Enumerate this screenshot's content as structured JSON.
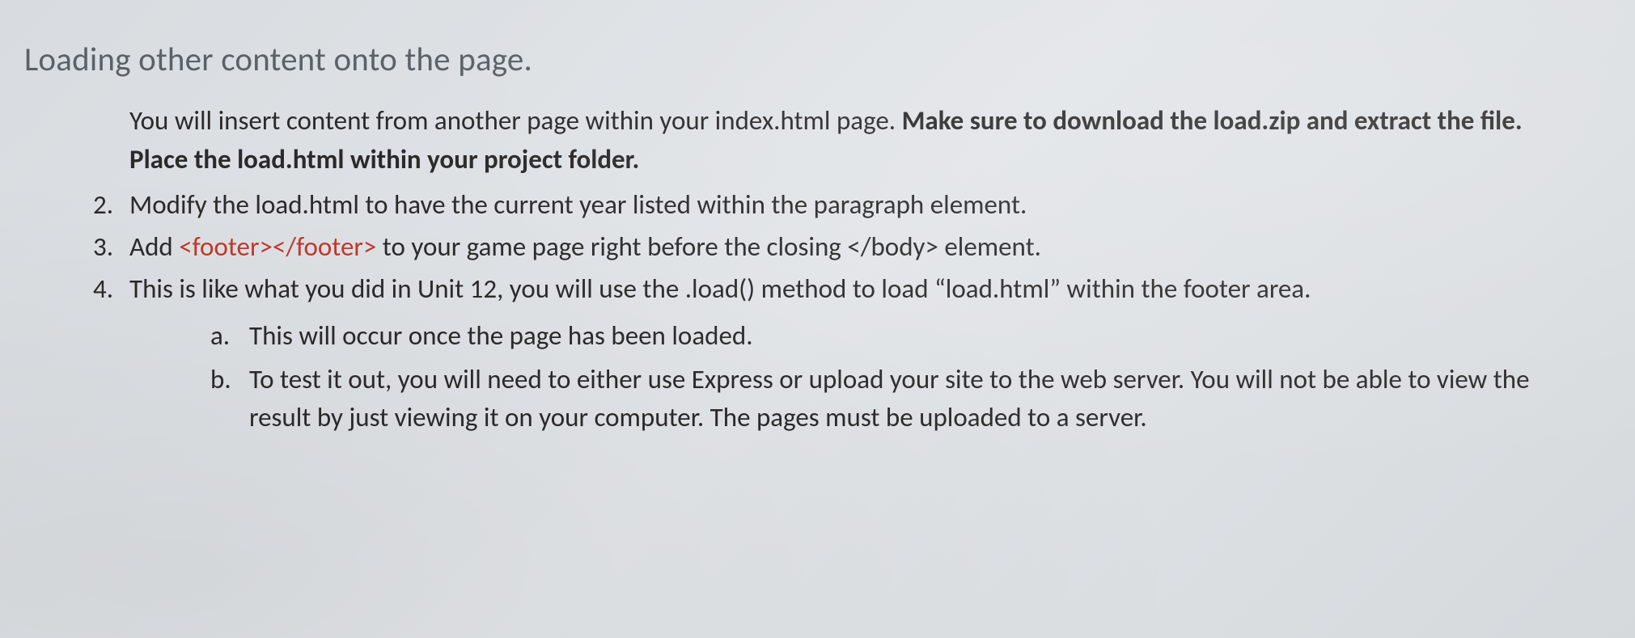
{
  "heading": "Loading other content onto the page.",
  "intro": {
    "text1": "You will insert content from another page within your index.html page. ",
    "boldText": "Make sure to download the load.zip and extract the file. Place the load.html within your project folder."
  },
  "items": [
    {
      "num": "2.",
      "text": "Modify the load.html to have the current year listed within the paragraph element."
    },
    {
      "num": "3.",
      "parts": {
        "before": "Add ",
        "code": "<footer></footer>",
        "after": "  to your game page right before the closing </body> element."
      }
    },
    {
      "num": "4.",
      "text": "This is like what you did in Unit 12, you will use the .load() method to load “load.html” within the footer area.",
      "sub": [
        {
          "num": "a.",
          "text": "This will occur once the page has been loaded."
        },
        {
          "num": "b.",
          "text": "To test it out, you will need to either use Express or upload your site to the web server. You will not be able to view the result by just viewing it on your computer.  The pages must be uploaded to a server."
        }
      ]
    }
  ]
}
